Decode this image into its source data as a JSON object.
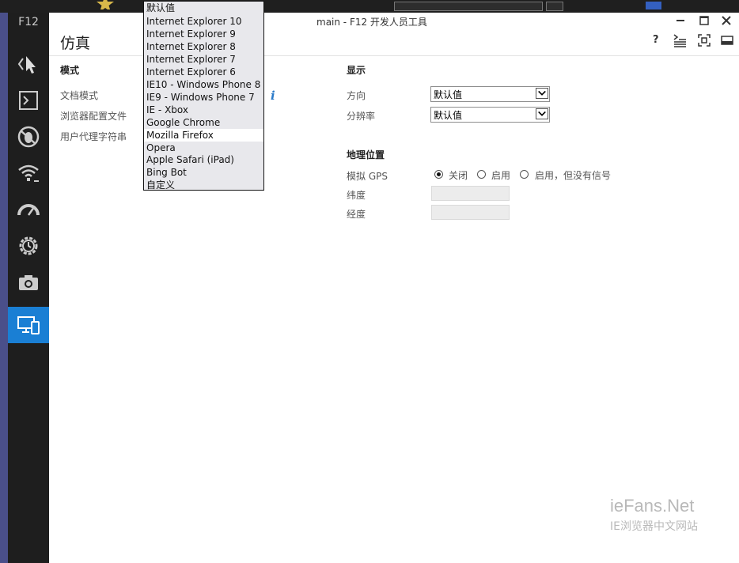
{
  "app": {
    "short_title": "F12",
    "window_title": "main - F12 开发人员工具"
  },
  "sidebar": {
    "tools": [
      {
        "name": "dom-explorer",
        "icon": "cursor-icon"
      },
      {
        "name": "console",
        "icon": "console-icon"
      },
      {
        "name": "debugger",
        "icon": "bug-icon"
      },
      {
        "name": "network",
        "icon": "wifi-icon"
      },
      {
        "name": "ui-responsiveness",
        "icon": "gauge-icon"
      },
      {
        "name": "memory",
        "icon": "gear-clock-icon"
      },
      {
        "name": "profiler",
        "icon": "camera-icon"
      },
      {
        "name": "emulation",
        "icon": "devices-icon",
        "active": true
      }
    ]
  },
  "page": {
    "title": "仿真"
  },
  "mode": {
    "heading": "模式",
    "document_mode_label": "文档模式",
    "browser_profile_label": "浏览器配置文件",
    "user_agent_label": "用户代理字符串",
    "info_icon": "i"
  },
  "display": {
    "heading": "显示",
    "orientation_label": "方向",
    "orientation_value": "默认值",
    "resolution_label": "分辨率",
    "resolution_value": "默认值"
  },
  "geolocation": {
    "heading": "地理位置",
    "gps_label": "模拟 GPS",
    "options": [
      "关闭",
      "启用",
      "启用，但没有信号"
    ],
    "selected": 0,
    "latitude_label": "纬度",
    "longitude_label": "经度"
  },
  "user_agent_dropdown": {
    "options": [
      "默认值",
      "Internet Explorer 10",
      "Internet Explorer 9",
      "Internet Explorer 8",
      "Internet Explorer 7",
      "Internet Explorer 6",
      "IE10 - Windows Phone 8",
      "IE9 - Windows Phone 7",
      "IE - Xbox",
      "Google Chrome",
      "Mozilla Firefox",
      "Opera",
      "Apple Safari (iPad)",
      "Bing Bot",
      "自定义"
    ],
    "highlighted": 10
  },
  "toolbar": {
    "help_label": "?"
  },
  "watermark": {
    "line1": "ieFans.Net",
    "line2": "IE浏览器中文网站"
  },
  "colors": {
    "accent": "#1a7fd4",
    "sidebar": "#1e1e1e",
    "edge": "#4a4f8a"
  }
}
